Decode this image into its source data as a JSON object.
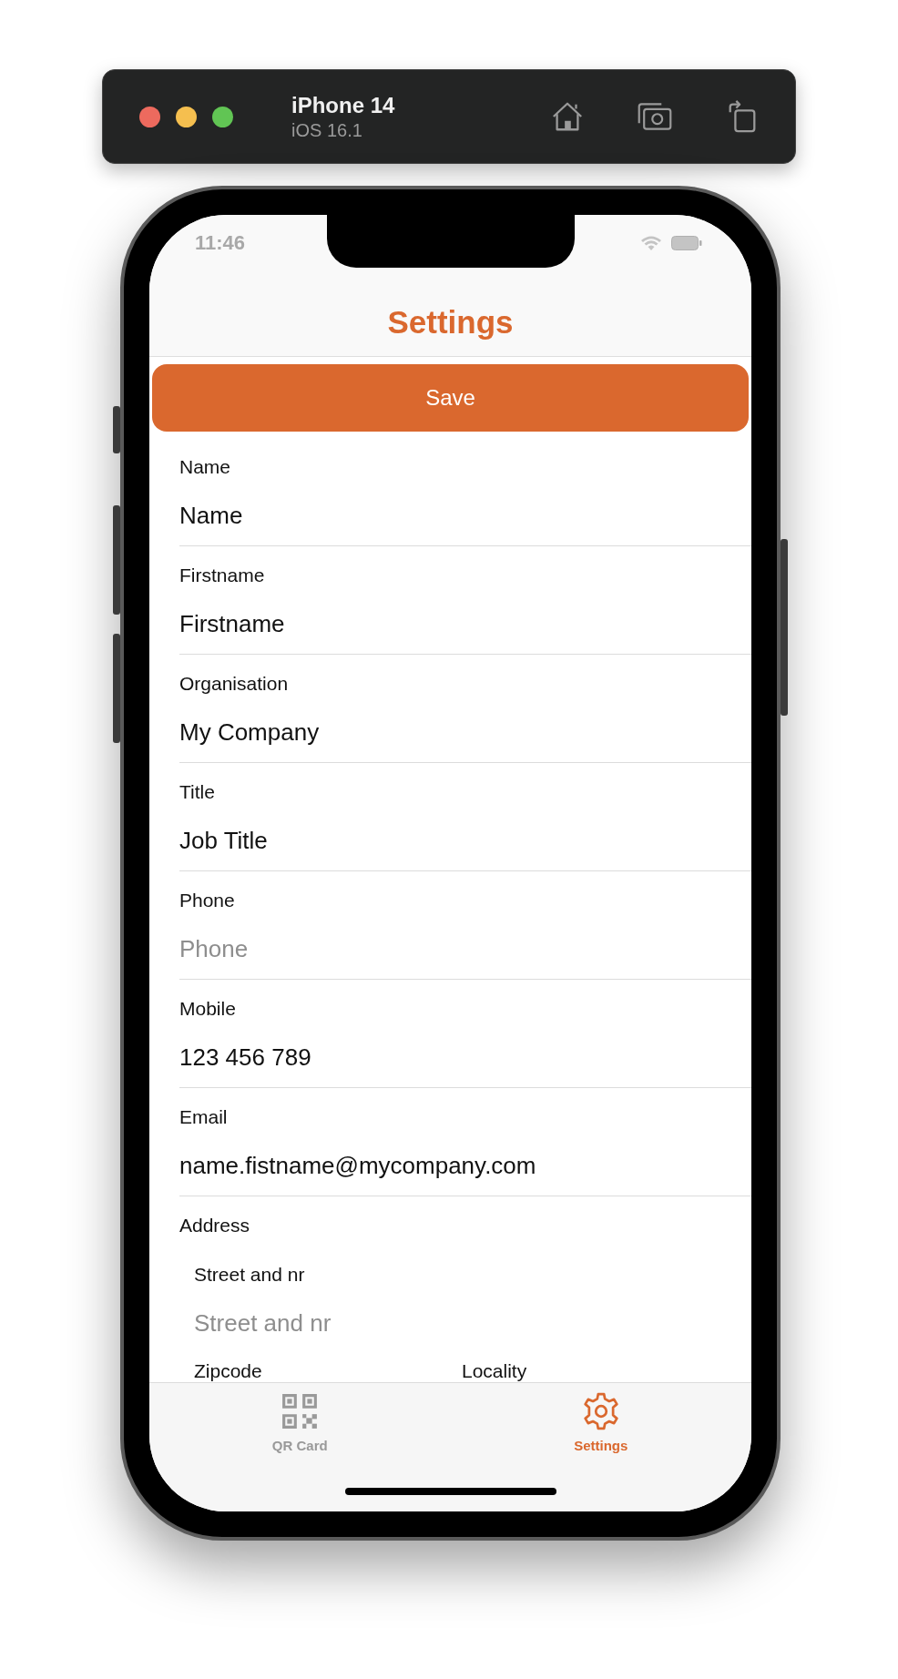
{
  "simulator": {
    "device": "iPhone 14",
    "os": "iOS 16.1"
  },
  "status_bar": {
    "time": "11:46"
  },
  "nav_bar": {
    "title": "Settings"
  },
  "save_button": {
    "label": "Save"
  },
  "fields": [
    {
      "label": "Name",
      "value": "Name"
    },
    {
      "label": "Firstname",
      "value": "Firstname"
    },
    {
      "label": "Organisation",
      "value": "My Company"
    },
    {
      "label": "Title",
      "value": "Job Title"
    },
    {
      "label": "Phone",
      "placeholder": "Phone"
    },
    {
      "label": "Mobile",
      "value": "123 456 789"
    },
    {
      "label": "Email",
      "value": "name.fistname@mycompany.com"
    }
  ],
  "address": {
    "label": "Address",
    "street": {
      "label": "Street and nr",
      "placeholder": "Street and nr"
    },
    "zipcode": {
      "label": "Zipcode"
    },
    "locality": {
      "label": "Locality"
    }
  },
  "tab_bar": [
    {
      "label": "QR Card",
      "kind": "qr",
      "selected": false
    },
    {
      "label": "Settings",
      "kind": "gear",
      "selected": true
    }
  ]
}
